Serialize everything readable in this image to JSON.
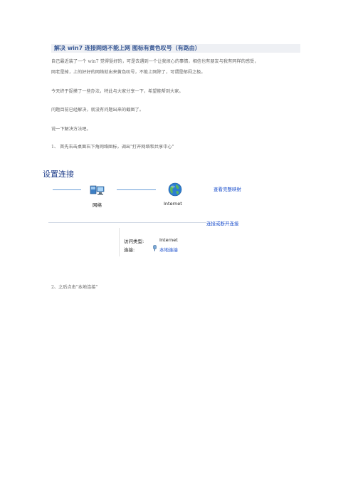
{
  "title": "解决 win7  连接网络不能上网  图标有黄色叹号（有路由）",
  "paragraphs": [
    "自己最近装了一个 win7  觉得挺好的，可是去遇到一个让我烦心的事情，相信也有朋友与我有同样的感受，",
    "网老是掉，上的好好的网络就出来黄色叹号，不能上网除了，可谓是郁闷之极。",
    "今天终于捉摸了一些办法，特此与大家分享一下，希望能帮到大家。",
    "问题目前已经解决，就没有问题出来的截图了。",
    "说一下解决方法吧。"
  ],
  "step1": "1、   首先右击桌面右下角网络图标，调出\"打开网络和共享中心\"",
  "step2": "2、之后点击\"本地连接\"",
  "screenshot": {
    "heading": "设置连接",
    "network_label": "网络",
    "internet_label": "Internet",
    "view_full_map": "查看完整映射",
    "connect_disconnect": "连接或断开连接",
    "access_type_key": "访问类型:",
    "access_type_value": "Internet",
    "connection_key": "连接:",
    "connection_value": "本地连接"
  },
  "colors": {
    "title": "#3a5a96",
    "link": "#1a4ecc",
    "line": "#6a9ed8"
  }
}
